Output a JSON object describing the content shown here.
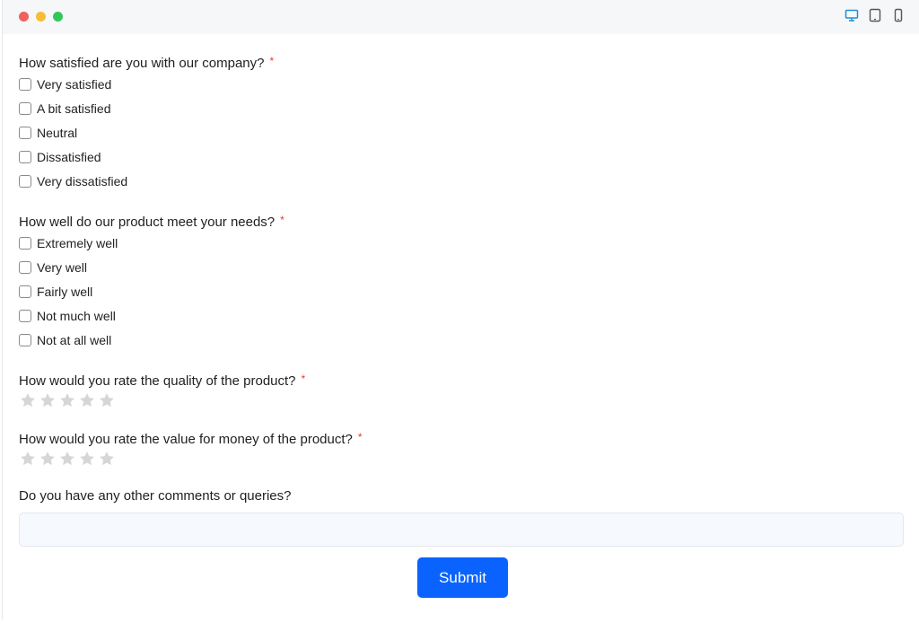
{
  "colors": {
    "accent": "#0a63ff",
    "required": "#e53935",
    "star_empty": "#d6d6d6",
    "device_active": "#1d8fd8"
  },
  "toolbar": {
    "devices": [
      "desktop-icon",
      "tablet-icon",
      "mobile-icon"
    ]
  },
  "questions": [
    {
      "label": "How satisfied are you with our company?",
      "required_mark": "*",
      "options": [
        "Very satisfied",
        "A bit satisfied",
        "Neutral",
        "Dissatisfied",
        "Very dissatisfied"
      ]
    },
    {
      "label": "How well do our product meet your needs?",
      "required_mark": "*",
      "options": [
        "Extremely well",
        "Very well",
        "Fairly well",
        "Not much well",
        "Not at all well"
      ]
    }
  ],
  "ratings": [
    {
      "label": "How would you rate the quality of the product?",
      "required_mark": "*",
      "value": 0,
      "max": 5
    },
    {
      "label": "How would you rate the value for money of the product?",
      "required_mark": "*",
      "value": 0,
      "max": 5
    }
  ],
  "comments": {
    "label": "Do you have any other comments or queries?",
    "value": "",
    "placeholder": ""
  },
  "submit_label": "Submit"
}
